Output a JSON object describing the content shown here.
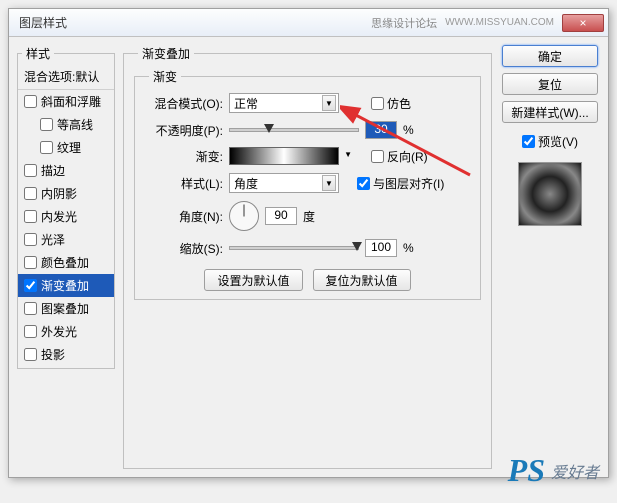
{
  "titlebar": {
    "title": "图层样式",
    "forum": "思缘设计论坛",
    "url": "WWW.MISSYUAN.COM",
    "close": "×"
  },
  "styles": {
    "legend": "样式",
    "blend_options": "混合选项:默认",
    "items": [
      {
        "label": "斜面和浮雕",
        "checked": false,
        "indent": false
      },
      {
        "label": "等高线",
        "checked": false,
        "indent": true
      },
      {
        "label": "纹理",
        "checked": false,
        "indent": true
      },
      {
        "label": "描边",
        "checked": false,
        "indent": false
      },
      {
        "label": "内阴影",
        "checked": false,
        "indent": false
      },
      {
        "label": "内发光",
        "checked": false,
        "indent": false
      },
      {
        "label": "光泽",
        "checked": false,
        "indent": false
      },
      {
        "label": "颜色叠加",
        "checked": false,
        "indent": false
      },
      {
        "label": "渐变叠加",
        "checked": true,
        "indent": false,
        "selected": true
      },
      {
        "label": "图案叠加",
        "checked": false,
        "indent": false
      },
      {
        "label": "外发光",
        "checked": false,
        "indent": false
      },
      {
        "label": "投影",
        "checked": false,
        "indent": false
      }
    ]
  },
  "center": {
    "legend": "渐变叠加",
    "inner_legend": "渐变",
    "blend_mode_label": "混合模式(O):",
    "blend_mode_value": "正常",
    "dither_label": "仿色",
    "opacity_label": "不透明度(P):",
    "opacity_value": "30",
    "opacity_unit": "%",
    "gradient_label": "渐变:",
    "reverse_label": "反向(R)",
    "style_label": "样式(L):",
    "style_value": "角度",
    "align_label": "与图层对齐(I)",
    "angle_label": "角度(N):",
    "angle_value": "90",
    "angle_unit": "度",
    "scale_label": "缩放(S):",
    "scale_value": "100",
    "scale_unit": "%",
    "btn_default": "设置为默认值",
    "btn_reset": "复位为默认值"
  },
  "right": {
    "ok": "确定",
    "cancel": "复位",
    "new_style": "新建样式(W)...",
    "preview_label": "预览(V)"
  },
  "watermark": {
    "ps": "PS",
    "txt": "爱好者"
  }
}
